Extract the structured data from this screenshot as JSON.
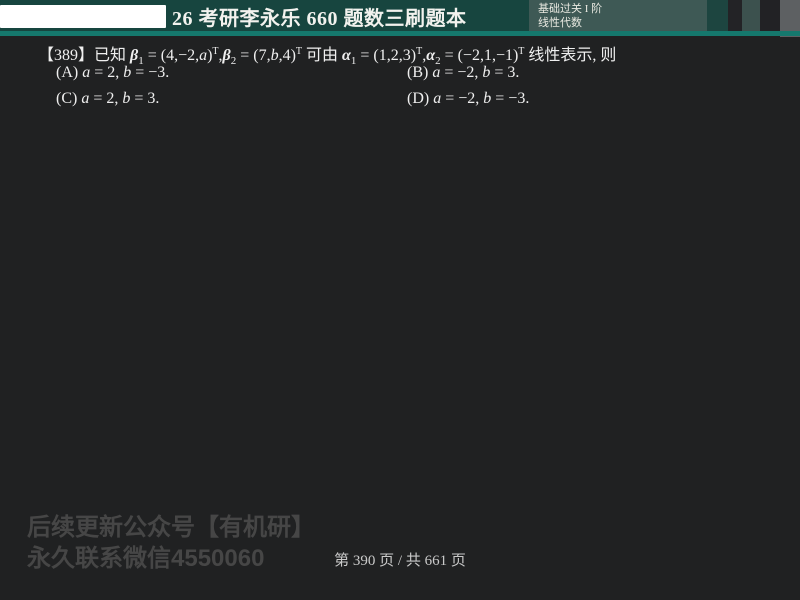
{
  "header": {
    "title": "26 考研李永乐 660 题数三刷题本",
    "badge": {
      "line1": "基础过关 I 阶",
      "line2": "线性代数"
    },
    "colors": {
      "header_bg": "#17453f",
      "accent_line": "#15786d",
      "badge_bg": "#3e5955"
    }
  },
  "question": {
    "parts": [
      "【389】已知 ",
      "β",
      "1",
      " = (4,−2,",
      "a",
      ")",
      "T",
      ",",
      "β",
      "2",
      " = (7,",
      "b",
      ",4)",
      "T",
      " 可由 ",
      "α",
      "1",
      " = (1,2,3)",
      "T",
      ",",
      "α",
      "2",
      " = (−2,1,−1)",
      "T",
      " 线性表示, 则"
    ]
  },
  "options": [
    {
      "label": "(A) ",
      "a": "a",
      "mid": " = 2, ",
      "b": "b",
      "end": " = −3."
    },
    {
      "label": "(B) ",
      "a": "a",
      "mid": " = −2, ",
      "b": "b",
      "end": " = 3."
    },
    {
      "label": "(C) ",
      "a": "a",
      "mid": " = 2, ",
      "b": "b",
      "end": " = 3."
    },
    {
      "label": "(D) ",
      "a": "a",
      "mid": " = −2, ",
      "b": "b",
      "end": " = −3."
    }
  ],
  "watermark": {
    "line1": "后续更新公众号【有机研】",
    "line2": "永久联系微信4550060"
  },
  "footer": {
    "page_indicator": "第 390 页 / 共 661 页"
  },
  "page": {
    "bg": "#202122",
    "text_color": "#efefef"
  }
}
